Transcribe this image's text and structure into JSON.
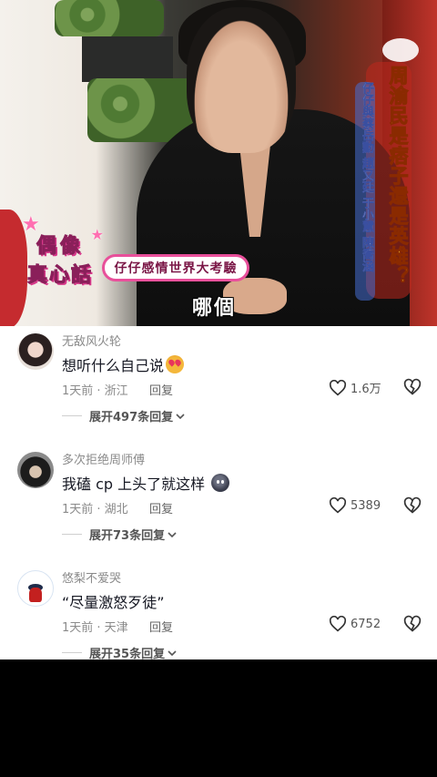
{
  "video": {
    "show_logo_line1": "偶像",
    "show_logo_line2": "真心話",
    "caption_box": "仔仔感情世界大考驗",
    "subtitle": "哪個",
    "vertical_title": "周渝民是痞子還是英雄？",
    "vertical_subtitle": "仔仔與蔡岳勳 趙又廷 于小慧 陳喬涵"
  },
  "comments": [
    {
      "username": "无敌风火轮",
      "text": "想听什么自己说",
      "emoji": "love-eyes-emoji",
      "time_location": "1天前 · 浙江",
      "reply_label": "回复",
      "like_count": "1.6万",
      "expand_label": "展开497条回复"
    },
    {
      "username": "多次拒绝周师傅",
      "text": "我磕 cp 上头了就这样",
      "emoji": "blob-emoji",
      "time_location": "1天前 · 湖北",
      "reply_label": "回复",
      "like_count": "5389",
      "expand_label": "展开73条回复"
    },
    {
      "username": "悠梨不爱哭",
      "text": "“尽量激怒歹徒”",
      "emoji": "",
      "time_location": "1天前 · 天津",
      "reply_label": "回复",
      "like_count": "6752",
      "expand_label": "展开35条回复"
    }
  ]
}
